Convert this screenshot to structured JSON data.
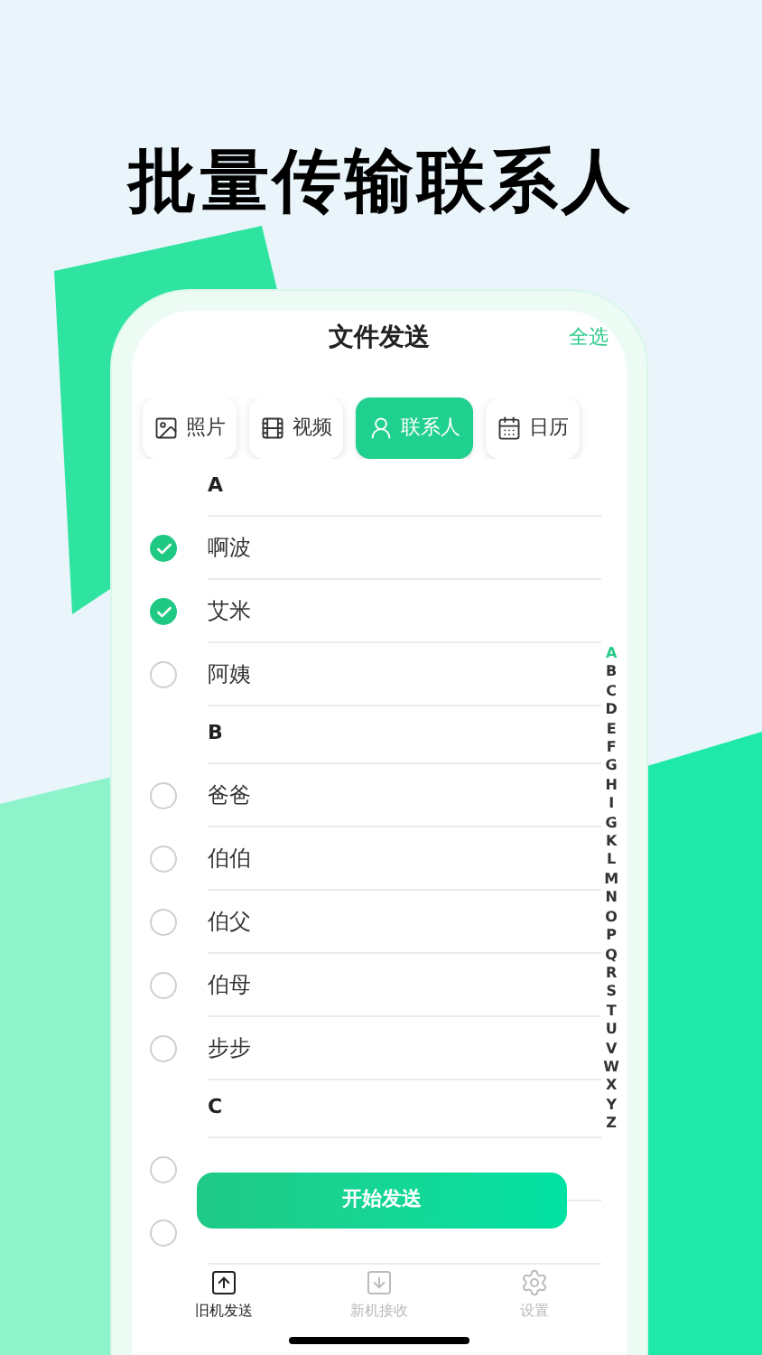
{
  "headline": "批量传输联系人",
  "screen": {
    "title": "文件发送",
    "select_all": "全选"
  },
  "tabs": [
    {
      "kind": "photo",
      "label": "照片",
      "selected": false
    },
    {
      "kind": "video",
      "label": "视频",
      "selected": false
    },
    {
      "kind": "contact",
      "label": "联系人",
      "selected": true
    },
    {
      "kind": "calendar",
      "label": "日历",
      "selected": false
    }
  ],
  "contacts": [
    {
      "letter": "A",
      "items": [
        {
          "name": "啊波",
          "checked": true
        },
        {
          "name": "艾米",
          "checked": true
        },
        {
          "name": "阿姨",
          "checked": false
        }
      ]
    },
    {
      "letter": "B",
      "items": [
        {
          "name": "爸爸",
          "checked": false
        },
        {
          "name": "伯伯",
          "checked": false
        },
        {
          "name": "伯父",
          "checked": false
        },
        {
          "name": "伯母",
          "checked": false
        },
        {
          "name": "步步",
          "checked": false
        }
      ]
    },
    {
      "letter": "C",
      "items": [
        {
          "checked": false
        },
        {
          "checked": false
        }
      ]
    }
  ],
  "index": [
    {
      "letter": "A",
      "selected": true
    },
    {
      "letter": "B",
      "selected": false
    },
    {
      "letter": "C",
      "selected": false
    },
    {
      "letter": "D",
      "selected": false
    },
    {
      "letter": "E",
      "selected": false
    },
    {
      "letter": "F",
      "selected": false
    },
    {
      "letter": "G",
      "selected": false
    },
    {
      "letter": "H",
      "selected": false
    },
    {
      "letter": "I",
      "selected": false
    },
    {
      "letter": "G",
      "selected": false
    },
    {
      "letter": "K",
      "selected": false
    },
    {
      "letter": "L",
      "selected": false
    },
    {
      "letter": "M",
      "selected": false
    },
    {
      "letter": "N",
      "selected": false
    },
    {
      "letter": "O",
      "selected": false
    },
    {
      "letter": "P",
      "selected": false
    },
    {
      "letter": "Q",
      "selected": false
    },
    {
      "letter": "R",
      "selected": false
    },
    {
      "letter": "S",
      "selected": false
    },
    {
      "letter": "T",
      "selected": false
    },
    {
      "letter": "U",
      "selected": false
    },
    {
      "letter": "V",
      "selected": false
    },
    {
      "letter": "W",
      "selected": false
    },
    {
      "letter": "X",
      "selected": false
    },
    {
      "letter": "Y",
      "selected": false
    },
    {
      "letter": "Z",
      "selected": false
    }
  ],
  "start_button": "开始发送",
  "nav": [
    {
      "kind": "send",
      "label": "旧机发送",
      "selected": true
    },
    {
      "kind": "receive",
      "label": "新机接收",
      "selected": false
    },
    {
      "kind": "settings",
      "label": "设置",
      "selected": false
    }
  ]
}
